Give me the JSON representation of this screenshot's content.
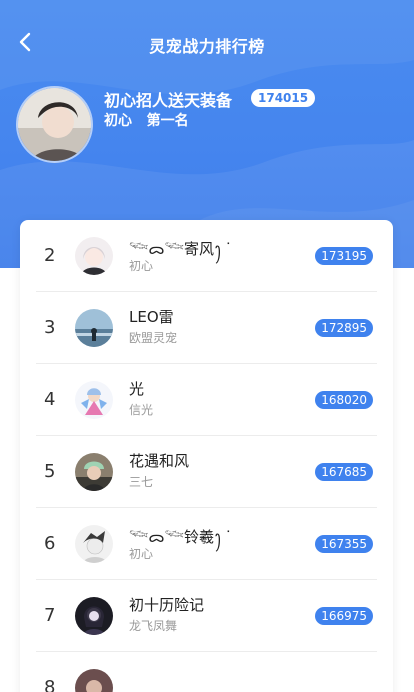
{
  "header": {
    "title": "灵宠战力排行榜",
    "back_icon": "chevron-left-icon"
  },
  "me": {
    "name": "初心招人送天装备",
    "score": "174015",
    "sub": "初心   第一名"
  },
  "rows": [
    {
      "rank": "2",
      "name": "𓆝ᯅ𓆝寄风ꫂ ᐝ",
      "sub": "初心",
      "score": "173195"
    },
    {
      "rank": "3",
      "name": "LEO雷",
      "sub": "欧盟灵宠",
      "score": "172895"
    },
    {
      "rank": "4",
      "name": "光",
      "sub": "信光",
      "score": "168020"
    },
    {
      "rank": "5",
      "name": "花遇和风",
      "sub": "三七",
      "score": "167685"
    },
    {
      "rank": "6",
      "name": "𓆝ᯅ𓆝铃羲ꫂ ᐝ",
      "sub": "初心",
      "score": "167355"
    },
    {
      "rank": "7",
      "name": "初十历险记",
      "sub": "龙飞凤舞",
      "score": "166975"
    },
    {
      "rank": "8",
      "name": "",
      "sub": "",
      "score": ""
    }
  ],
  "colors": {
    "accent": "#3f82ee",
    "header_bg": "#4585ee"
  }
}
